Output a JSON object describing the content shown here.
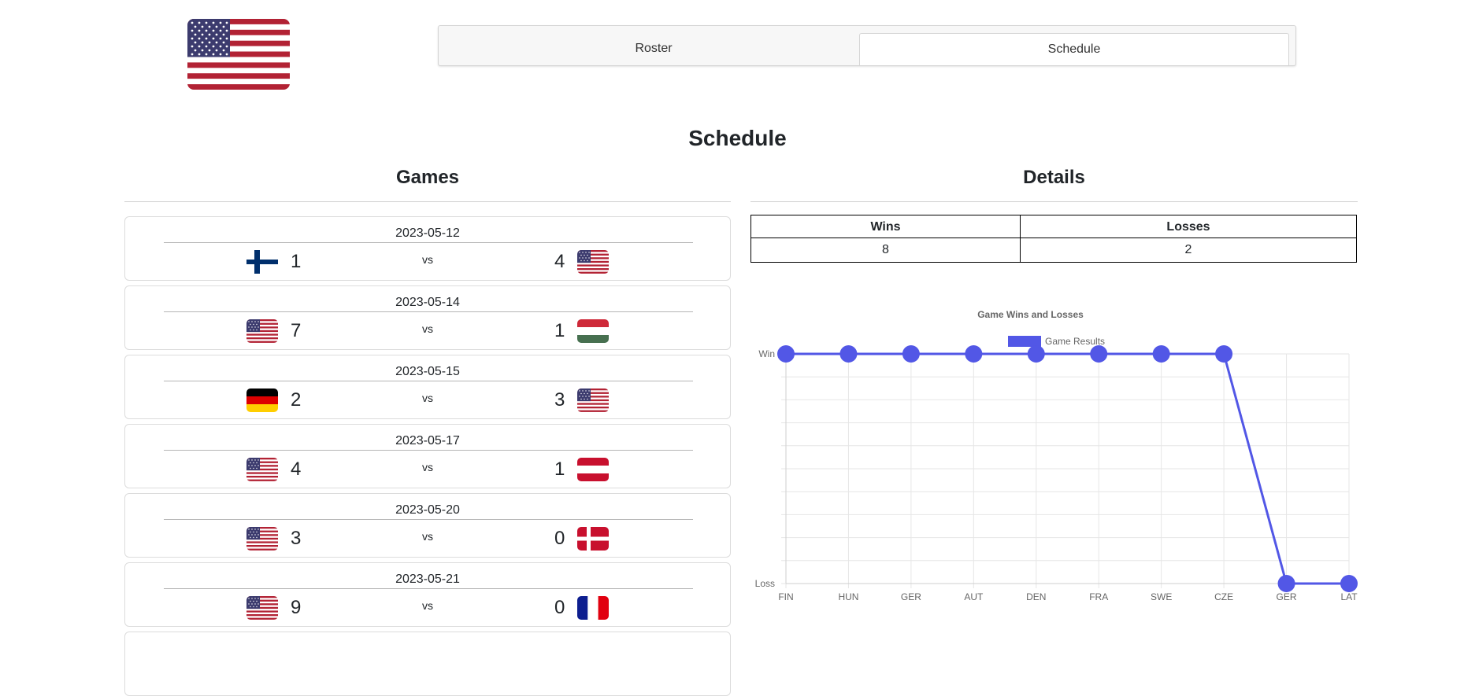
{
  "team": {
    "flag": "usa-flag"
  },
  "tabs": {
    "roster": "Roster",
    "schedule": "Schedule",
    "active": "Schedule"
  },
  "page": {
    "title": "Schedule",
    "games_heading": "Games",
    "details_heading": "Details"
  },
  "games": [
    {
      "date": "2023-05-12",
      "team_a_flag": "fin",
      "score_a": "1",
      "vs": "vs",
      "score_b": "4",
      "team_b_flag": "usa"
    },
    {
      "date": "2023-05-14",
      "team_a_flag": "usa",
      "score_a": "7",
      "vs": "vs",
      "score_b": "1",
      "team_b_flag": "hun"
    },
    {
      "date": "2023-05-15",
      "team_a_flag": "ger",
      "score_a": "2",
      "vs": "vs",
      "score_b": "3",
      "team_b_flag": "usa"
    },
    {
      "date": "2023-05-17",
      "team_a_flag": "usa",
      "score_a": "4",
      "vs": "vs",
      "score_b": "1",
      "team_b_flag": "aut"
    },
    {
      "date": "2023-05-20",
      "team_a_flag": "usa",
      "score_a": "3",
      "vs": "vs",
      "score_b": "0",
      "team_b_flag": "den"
    },
    {
      "date": "2023-05-21",
      "team_a_flag": "usa",
      "score_a": "9",
      "vs": "vs",
      "score_b": "0",
      "team_b_flag": "fra"
    }
  ],
  "stats": {
    "wins_label": "Wins",
    "losses_label": "Losses",
    "wins": "8",
    "losses": "2"
  },
  "chart_data": {
    "type": "line",
    "title": "Game Wins and Losses",
    "categories": [
      "FIN",
      "HUN",
      "GER",
      "AUT",
      "DEN",
      "FRA",
      "SWE",
      "CZE",
      "GER",
      "LAT"
    ],
    "y_tick_labels": [
      "Loss",
      "Win"
    ],
    "series": [
      {
        "name": "Game Results",
        "values": [
          1,
          1,
          1,
          1,
          1,
          1,
          1,
          1,
          0,
          0
        ]
      }
    ],
    "ylim": [
      0,
      1
    ],
    "grid": true,
    "legend": "top",
    "color": "#5257e6"
  },
  "colors": {
    "accent": "#5257e6",
    "border": "#dcdcdc"
  }
}
